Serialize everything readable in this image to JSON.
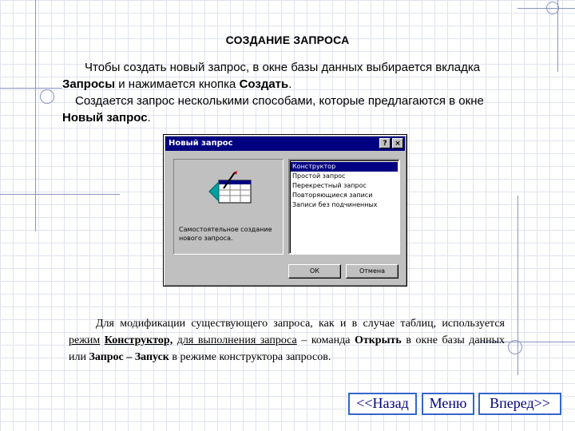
{
  "slide": {
    "title": "СОЗДАНИЕ ЗАПРОСА"
  },
  "intro": {
    "p1_a": "Чтобы создать новый запрос, в окне базы данных выбирается вкладка ",
    "p1_b": "Запросы",
    "p1_c": " и нажимается кнопка ",
    "p1_d": "Создать",
    "p1_e": ".",
    "p2_a": "Создается запрос несколькими способами, которые предлагаются в окне ",
    "p2_b": "Новый запрос",
    "p2_c": "."
  },
  "dialog": {
    "title": "Новый запрос",
    "help_glyph": "?",
    "close_glyph": "×",
    "preview_caption": "Самостоятельное создание нового запроса.",
    "list": [
      "Конструктор",
      "Простой запрос",
      "Перекрестный запрос",
      "Повторяющиеся записи",
      "Записи без подчиненных"
    ],
    "selected_index": 0,
    "ok_label": "ОК",
    "cancel_label": "Отмена"
  },
  "body": {
    "t1": "Для модификации существующего запроса, как и в случае таблиц, используется ",
    "t2": "режим",
    "t3": "Конструктор,",
    "t4": "для выполнения запроса",
    "t5": " – команда ",
    "t6": "Открыть",
    "t7": " в окне базы данных или ",
    "t8": "Запрос – Запуск",
    "t9": " в режиме конструктора запросов."
  },
  "nav": {
    "back": "<<Назад",
    "menu": "Меню",
    "forward": "Вперед>>"
  },
  "colors": {
    "titlebar": "#000080",
    "selection": "#000080",
    "nav_border": "#3366cc",
    "nav_text": "#000080",
    "decor_lines": "#8a94c0",
    "grid": "#dfe3ee"
  }
}
